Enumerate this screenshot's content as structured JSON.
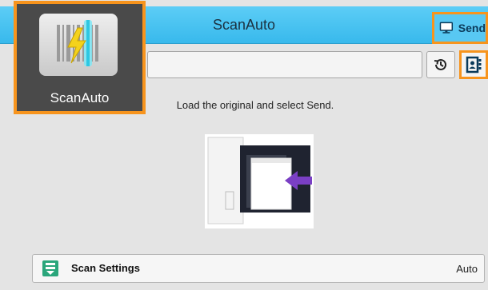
{
  "app": {
    "name": "ScanAuto",
    "icon": "scanauto-icon"
  },
  "header": {
    "title": "ScanAuto",
    "send_label": "Send",
    "send_icon": "monitor-icon"
  },
  "recipient": {
    "value": "",
    "history_icon": "history-icon",
    "address_book_icon": "address-book-icon"
  },
  "main": {
    "instruction": "Load the original and select Send.",
    "illustration_icon": "document-feeder-icon"
  },
  "settings": {
    "label": "Scan Settings",
    "value": "Auto",
    "icon": "scan-settings-icon"
  },
  "colors": {
    "header": "#42bff0",
    "highlight": "#f7941d",
    "tile": "#4a4a4a",
    "background": "#e4e4e4",
    "arrow": "#7a3fc4",
    "icon_accent": "#2aa67b"
  }
}
